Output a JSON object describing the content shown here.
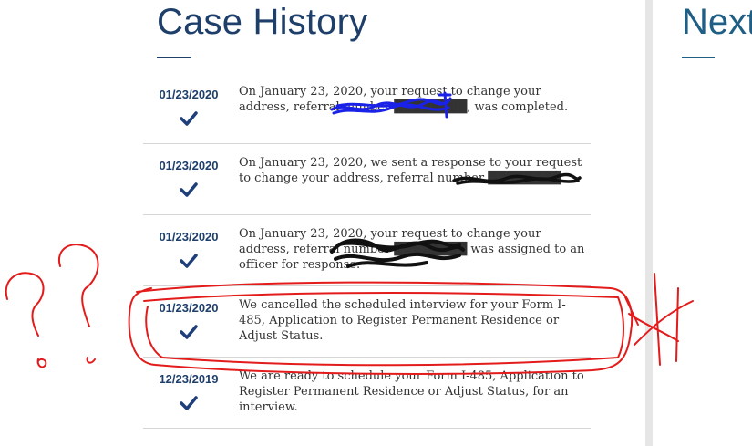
{
  "case_history": {
    "title": "Case History",
    "entries": [
      {
        "date": "01/23/2020",
        "text": "On January 23, 2020, your request to change your address, referral number ████████, was completed."
      },
      {
        "date": "01/23/2020",
        "text": "On January 23, 2020, we sent a response to your request to change your address, referral number ████████"
      },
      {
        "date": "01/23/2020",
        "text": "On January 23, 2020, your request to change your address, referral number ████████ was assigned to an officer for response."
      },
      {
        "date": "01/23/2020",
        "text": "We cancelled the scheduled interview for your Form I-485, Application to Register Permanent Residence or Adjust Status."
      },
      {
        "date": "12/23/2019",
        "text": "We are ready to schedule your Form I-485, Application to Register Permanent Residence or Adjust Status, for an interview."
      }
    ]
  },
  "next_section": {
    "title": "Next"
  },
  "icons": {
    "status_check": "checkmark-icon"
  },
  "colors": {
    "heading": "#1f3f6b",
    "check": "#1f3f7a",
    "annotation_red": "#e31b1b",
    "redaction_blue": "#1a22e8"
  }
}
